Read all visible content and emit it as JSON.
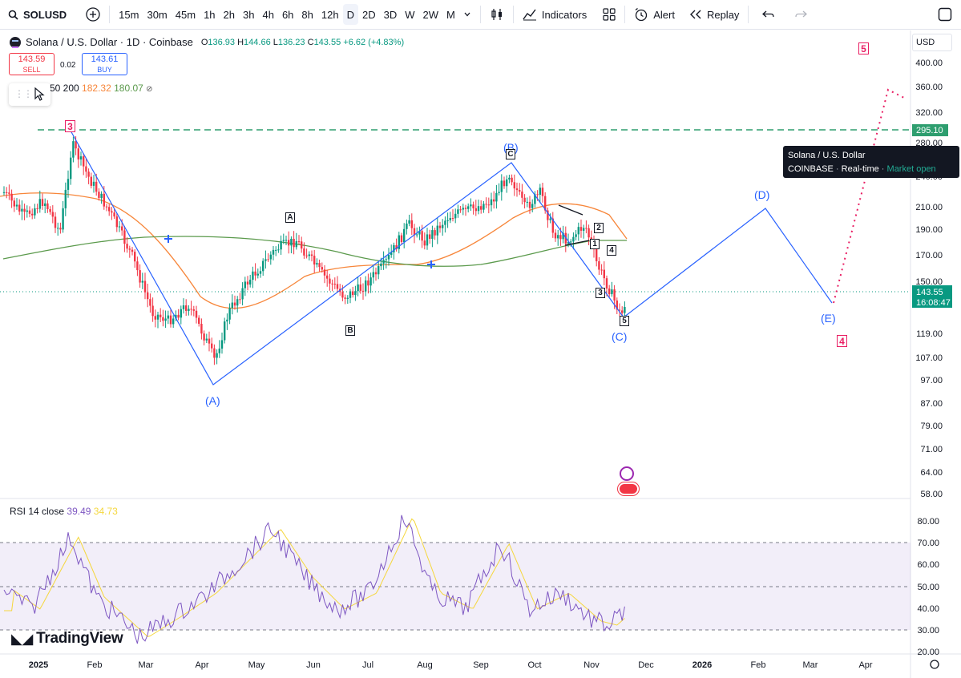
{
  "toolbar": {
    "symbol": "SOLUSD",
    "intervals": [
      "15m",
      "30m",
      "45m",
      "1h",
      "2h",
      "3h",
      "4h",
      "6h",
      "8h",
      "12h",
      "D",
      "2D",
      "3D",
      "W",
      "2W",
      "M"
    ],
    "active_interval": "D",
    "indicators_label": "Indicators",
    "alert_label": "Alert",
    "replay_label": "Replay"
  },
  "legend": {
    "title": "Solana / U.S. Dollar · 1D · Coinbase",
    "o_label": "O",
    "o": "136.93",
    "h_label": "H",
    "h": "144.66",
    "l_label": "L",
    "l": "136.23",
    "c_label": "C",
    "c": "143.55",
    "change": "+6.62 (+4.83%)"
  },
  "trade": {
    "sell_price": "143.59",
    "sell_label": "SELL",
    "spread": "0.02",
    "buy_price": "143.61",
    "buy_label": "BUY"
  },
  "ma": {
    "label": "50 200",
    "ma50": "182.32",
    "ma200": "180.07"
  },
  "tooltip": {
    "title": "Solana / U.S. Dollar",
    "exchange": "COINBASE",
    "feed": "Real-time",
    "status": "Market open",
    "sep": "·"
  },
  "price_axis": {
    "currency": "USD",
    "ticks": [
      "400.00",
      "360.00",
      "320.00",
      "280.00",
      "240.00",
      "210.00",
      "190.00",
      "170.00",
      "150.00",
      "119.00",
      "107.00",
      "97.00",
      "87.00",
      "79.00",
      "71.00",
      "64.00",
      "58.00"
    ],
    "level_tag": "295.10",
    "last_price": "143.55",
    "countdown": "16:08:47"
  },
  "rsi": {
    "label": "RSI 14 close",
    "value": "39.49",
    "ma_value": "34.73",
    "ticks": [
      "80.00",
      "70.00",
      "60.00",
      "50.00",
      "40.00",
      "30.00",
      "20.00"
    ]
  },
  "time_axis": [
    "2025",
    "Feb",
    "Mar",
    "Apr",
    "May",
    "Jun",
    "Jul",
    "Aug",
    "Sep",
    "Oct",
    "Nov",
    "Dec",
    "2026",
    "Feb",
    "Mar",
    "Apr"
  ],
  "waves": {
    "A": "(A)",
    "B": "(B)",
    "C": "(C)",
    "D": "(D)",
    "E": "(E)",
    "box_A": "A",
    "box_B": "B",
    "box_C": "C",
    "sub": [
      "1",
      "2",
      "3",
      "4",
      "5"
    ],
    "red": [
      "3",
      "5",
      "4"
    ]
  },
  "brand": "TradingView",
  "colors": {
    "up": "#089981",
    "down": "#f23645",
    "wave": "#2962ff",
    "ma50": "#f7863a",
    "ma200": "#5b9a4c",
    "rsi": "#7e57c2",
    "rsi_ma": "#f5d73d",
    "level": "#2e9e6f",
    "target": "#e91e63"
  }
}
